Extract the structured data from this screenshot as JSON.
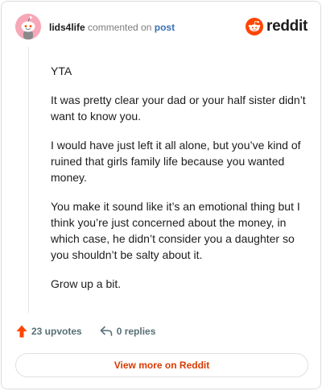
{
  "header": {
    "username": "lids4life",
    "commented_text": "commented on",
    "post_link": "post",
    "brand": "reddit"
  },
  "comment": {
    "paragraphs": [
      "YTA",
      "It was pretty clear your dad or your half sister didn’t want to know you.",
      "I would have just left it all alone, but you’ve kind of ruined that girls family life because you wanted money.",
      "You make it sound like it’s an emotional thing but I think you’re just concerned about the money, in which case, he didn’t consider you a daughter so you shouldn’t be salty about it.",
      "Grow up a bit."
    ]
  },
  "actions": {
    "upvotes": "23 upvotes",
    "replies": "0 replies"
  },
  "footer": {
    "view_more": "View more on Reddit"
  },
  "colors": {
    "accent": "#ff4500",
    "link": "#3b6fb0",
    "avatar_bg": "#f7a8b8"
  },
  "icons": [
    "avatar-snoo-icon",
    "reddit-logo-icon",
    "upvote-arrow-icon",
    "reply-arrow-icon"
  ]
}
